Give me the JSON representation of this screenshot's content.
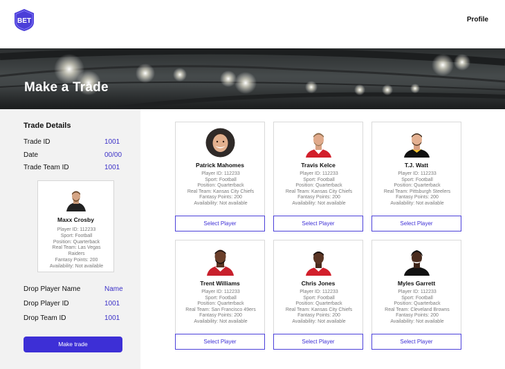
{
  "header": {
    "logo_text": "BET",
    "profile_label": "Profile"
  },
  "hero": {
    "title": "Make a Trade"
  },
  "trade_details": {
    "section_title": "Trade Details",
    "trade_id_label": "Trade ID",
    "trade_id_value": "1001",
    "date_label": "Date",
    "date_value": "00/00",
    "trade_team_id_label": "Trade Team ID",
    "trade_team_id_value": "1001",
    "drop_player": {
      "name": "Maxx Crosby",
      "player_id": "Player ID: 112233",
      "sport": "Sport: Football",
      "position": "Position: Quarterback",
      "real_team_line1": "Real Team: Las Vegas",
      "real_team_line2": "Raiders",
      "fantasy_points": "Fantasy Points: 200",
      "availability": "Availability: Not available"
    },
    "drop_player_name_label": "Drop Player Name",
    "drop_player_name_value": "Name",
    "drop_player_id_label": "Drop Player ID",
    "drop_player_id_value": "1001",
    "drop_team_id_label": "Drop Team ID",
    "drop_team_id_value": "1001",
    "make_trade_label": "Make trade"
  },
  "players": [
    {
      "name": "Patrick Mahomes",
      "player_id": "Player ID: 112233",
      "sport": "Sport: Football",
      "position": "Position: Quarterback",
      "real_team": "Real Team: Kansas City Chiefs",
      "fantasy_points": "Fantasy Points: 200",
      "availability": "Availability: Not available",
      "select_label": "Select Player"
    },
    {
      "name": "Travis Kelce",
      "player_id": "Player ID: 112233",
      "sport": "Sport: Football",
      "position": "Position: Quarterback",
      "real_team": "Real Team: Kansas City Chiefs",
      "fantasy_points": "Fantasy Points: 200",
      "availability": "Availability: Not available",
      "select_label": "Select Player"
    },
    {
      "name": "T.J. Watt",
      "player_id": "Player ID: 112233",
      "sport": "Sport: Football",
      "position": "Position: Quarterback",
      "real_team": "Real Team: Pittsburgh Steelers",
      "fantasy_points": "Fantasy Points: 200",
      "availability": "Availability: Not available",
      "select_label": "Select Player"
    },
    {
      "name": "Trent Williams",
      "player_id": "Player ID: 112233",
      "sport": "Sport: Football",
      "position": "Position: Quarterback",
      "real_team": "Real Team: San Francisco 49ers",
      "fantasy_points": "Fantasy Points: 200",
      "availability": "Availability: Not available",
      "select_label": "Select Player"
    },
    {
      "name": "Chris Jones",
      "player_id": "Player ID: 112233",
      "sport": "Sport: Football",
      "position": "Position: Quarterback",
      "real_team": "Real Team: Kansas City Chiefs",
      "fantasy_points": "Fantasy Points: 200",
      "availability": "Availability: Not available",
      "select_label": "Select Player"
    },
    {
      "name": "Myles Garrett",
      "player_id": "Player ID: 112233",
      "sport": "Sport: Football",
      "position": "Position: Quarterback",
      "real_team": "Real Team: Cleveland Browns",
      "fantasy_points": "Fantasy Points: 200",
      "availability": "Availability: Not available",
      "select_label": "Select Player"
    }
  ],
  "colors": {
    "accent": "#3d2fd6",
    "value_text": "#3a2fc7",
    "panel_bg": "#f2f2f2"
  }
}
